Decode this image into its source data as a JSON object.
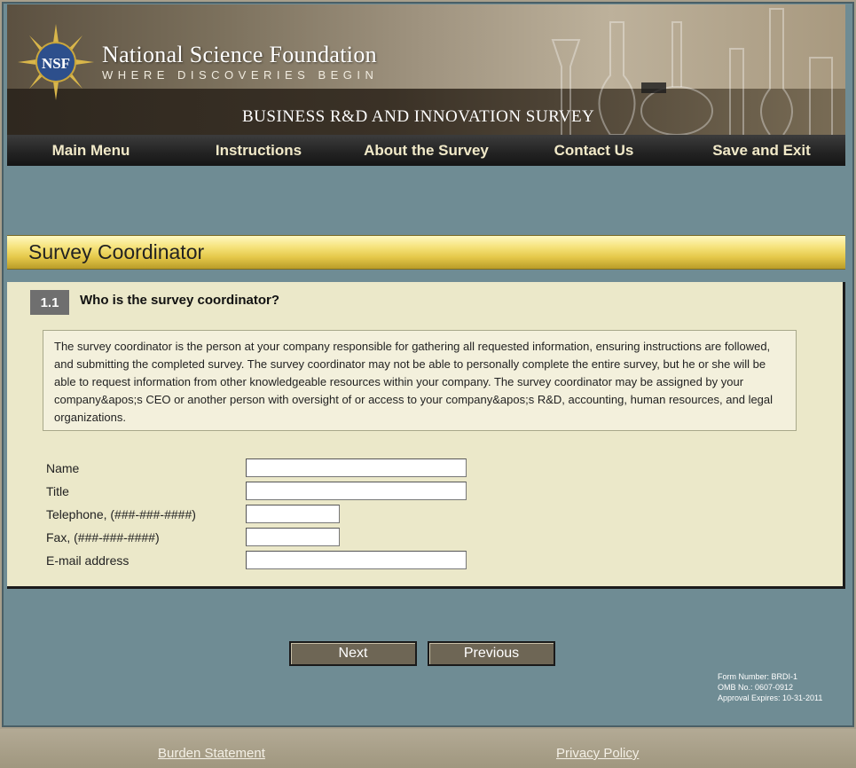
{
  "header": {
    "org_name": "National Science Foundation",
    "tagline": "WHERE DISCOVERIES BEGIN",
    "logo_text": "NSF",
    "survey_title": "BUSINESS R&D AND INNOVATION SURVEY"
  },
  "nav": {
    "items": [
      {
        "label": "Main Menu"
      },
      {
        "label": "Instructions"
      },
      {
        "label": "About the Survey"
      },
      {
        "label": "Contact Us"
      },
      {
        "label": "Save and Exit"
      }
    ]
  },
  "section": {
    "title": "Survey Coordinator"
  },
  "question": {
    "number": "1.1",
    "text": "Who is the survey coordinator?",
    "info": "The survey coordinator is the person at your company responsible for gathering all requested information, ensuring instructions are followed, and submitting the completed survey. The survey coordinator may not be able to personally complete the entire survey, but he or she will be able to request information from other knowledgeable resources within your company. The survey coordinator may be assigned by your company&apos;s CEO or another person with oversight of or access to your company&apos;s R&D, accounting, human resources, and legal organizations."
  },
  "fields": {
    "name": {
      "label": "Name",
      "value": ""
    },
    "title": {
      "label": "Title",
      "value": ""
    },
    "telephone": {
      "label": "Telephone, (###-###-####)",
      "value": ""
    },
    "fax": {
      "label": "Fax, (###-###-####)",
      "value": ""
    },
    "email": {
      "label": "E-mail address",
      "value": ""
    }
  },
  "buttons": {
    "next": "Next",
    "previous": "Previous"
  },
  "form_meta": {
    "form_number": "Form Number: BRDI-1",
    "omb": "OMB No.: 0607-0912",
    "expires": "Approval Expires: 10-31-2011"
  },
  "footer": {
    "burden": "Burden Statement",
    "privacy": "Privacy Policy"
  },
  "colors": {
    "background": "#6f8c94",
    "nav_text": "#f1e9c8",
    "panel": "#ebe8c9",
    "section_bar": "#e5c84a",
    "button": "#6e6655"
  }
}
